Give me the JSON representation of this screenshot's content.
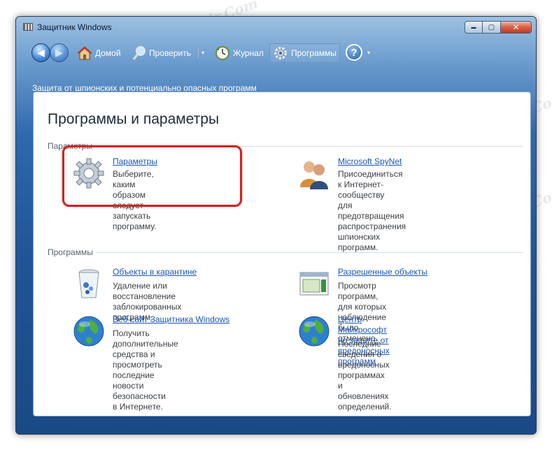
{
  "window": {
    "title": "Защитник Windows"
  },
  "titlebar_controls": {
    "minimize": "▬",
    "maximize": "▢",
    "close": "✕"
  },
  "toolbar": {
    "back_icon": "arrow-left-icon",
    "forward_icon": "arrow-right-icon",
    "home_label": "Домой",
    "scan_label": "Проверить",
    "history_label": "Журнал",
    "tools_label": "Программы",
    "help_label": "?",
    "dropdown_glyph": "▾"
  },
  "subtitle": "Защита от шпионских  и потенциально опасных программ",
  "page_title": "Программы и параметры",
  "sections": {
    "settings_header": "Параметры",
    "programs_header": "Программы"
  },
  "settings_items": [
    {
      "link": "Параметры",
      "desc": "Выберите, каким образом\nследует запускать программу."
    },
    {
      "link": "Microsoft SpyNet",
      "desc": "Присоединиться к Интернет-сообществу\nдля предотвращения распространения\nшпионских программ."
    }
  ],
  "program_items": [
    {
      "link": "Объекты в карантине",
      "desc": "Удаление или восстановление\nзаблокированных программ."
    },
    {
      "link": "Разрешенные объекты",
      "desc": "Просмотр программ, для которых\nнаблюдение было отменено."
    },
    {
      "link": "Веб-сайт Защитника Windows",
      "desc": "Получить дополнительные\nсредства и просмотреть\nпоследние новости безопасности\nв Интернете."
    },
    {
      "link": "Центр Майкрософт по защите от\nвредоносных программ",
      "desc": "Последние сведения о вредоносных\nпрограммах и обновлениях определений."
    }
  ],
  "watermark": "Soringpcrepair.Com",
  "colors": {
    "link": "#1a56b8",
    "highlight": "#d62020",
    "titlebar": "#2f68ad"
  }
}
